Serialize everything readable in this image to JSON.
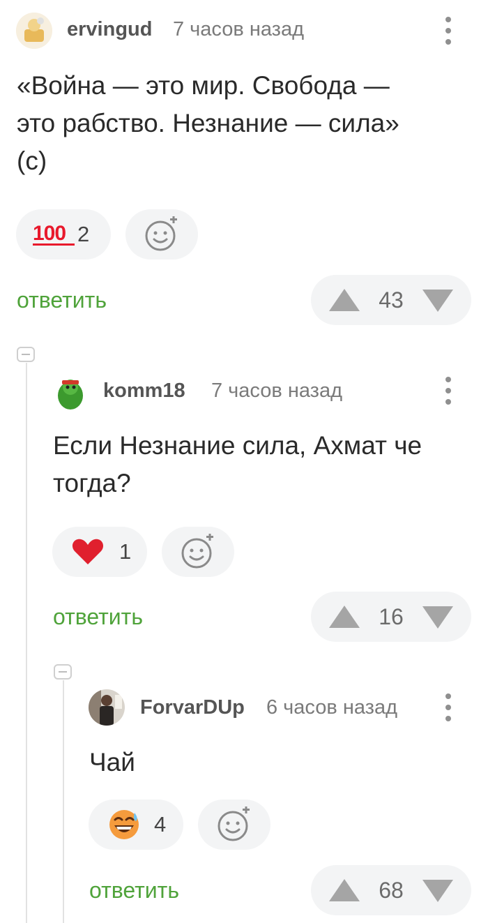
{
  "comments": [
    {
      "author": "ervingud",
      "time": "7 часов назад",
      "text_lines": [
        "«Война — это мир. Свобода —",
        "это рабство. Незнание — сила»",
        "(с)"
      ],
      "reaction": {
        "icon": "hundred-points-emoji",
        "count": "2"
      },
      "reply_label": "ответить",
      "rating": "43"
    },
    {
      "author": "komm18",
      "time": "7 часов назад",
      "text_lines": [
        "Если Незнание сила, Ахмат че",
        "тогда?"
      ],
      "reaction": {
        "icon": "red-heart-emoji",
        "count": "1"
      },
      "reply_label": "ответить",
      "rating": "16"
    },
    {
      "author": "ForvarDUp",
      "time": "6 часов назад",
      "text_lines": [
        "Чай"
      ],
      "reaction": {
        "icon": "grinning-sweat-emoji",
        "count": "4"
      },
      "reply_label": "ответить",
      "rating": "68"
    }
  ],
  "colors": {
    "reply": "#4fa33a",
    "pill_bg": "#f3f4f5",
    "vote_arrow": "#a5a5a5"
  }
}
